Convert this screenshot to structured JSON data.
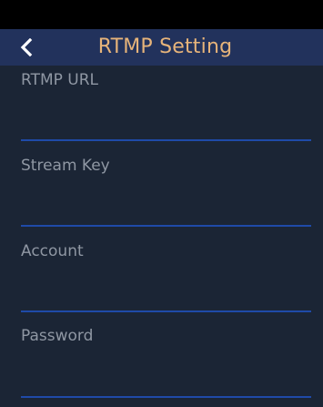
{
  "header": {
    "back_icon": "chevron-left-icon",
    "title": "RTMP Setting"
  },
  "form": {
    "fields": [
      {
        "label": "RTMP URL",
        "value": ""
      },
      {
        "label": "Stream Key",
        "value": ""
      },
      {
        "label": "Account",
        "value": ""
      },
      {
        "label": "Password",
        "value": ""
      }
    ]
  },
  "colors": {
    "background": "#1b2535",
    "header_background": "#22325c",
    "title": "#e7b47a",
    "label": "#8f97a3",
    "underline": "#1f4aa8"
  }
}
